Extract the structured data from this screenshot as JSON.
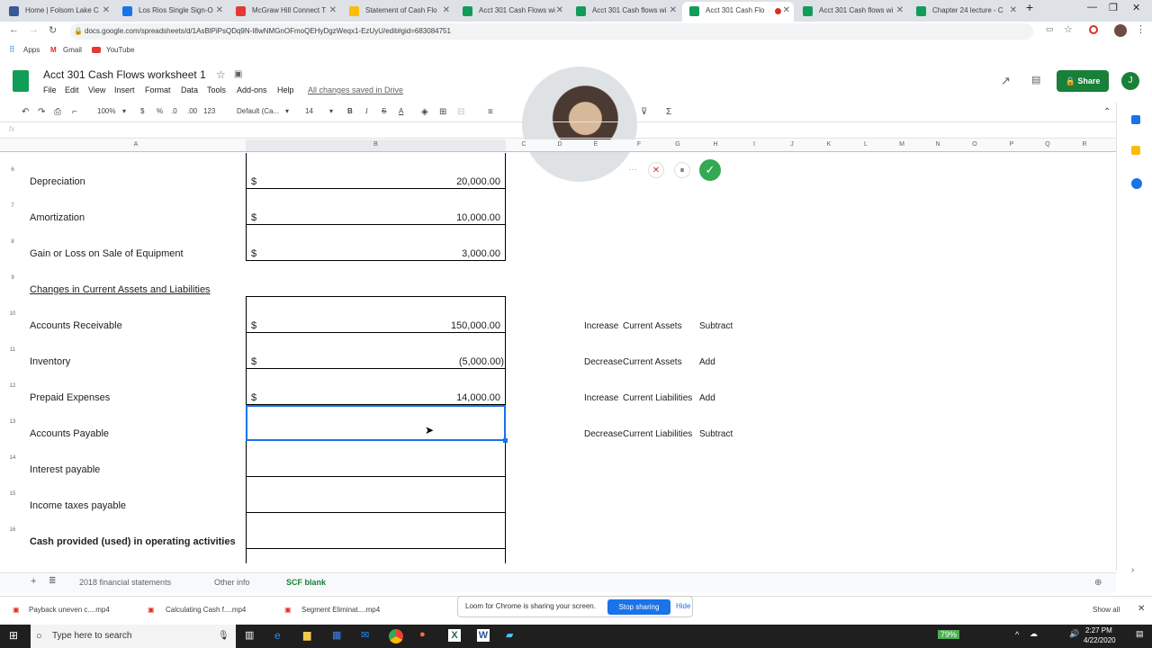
{
  "browser": {
    "tabs": [
      {
        "title": "Home | Folsom Lake C",
        "color": "#3b5998"
      },
      {
        "title": "Los Rios Single Sign-O",
        "color": "#1a73e8"
      },
      {
        "title": "McGraw Hill Connect T",
        "color": "#e53935"
      },
      {
        "title": "Statement of Cash Flo",
        "color": "#fbbc04"
      },
      {
        "title": "Acct 301 Cash Flows wi",
        "color": "#0f9d58"
      },
      {
        "title": "Acct 301 Cash flows wi",
        "color": "#0f9d58"
      },
      {
        "title": "Acct 301 Cash Flo",
        "color": "#0f9d58"
      },
      {
        "title": "Acct 301 Cash flows wi",
        "color": "#0f9d58"
      },
      {
        "title": "Chapter 24 lecture - C",
        "color": "#0f9d58"
      }
    ],
    "url": "docs.google.com/spreadsheets/d/1AsBlPiPsQDq9N-I8wNMGnOFmoQEHyDgzWeqx1-EzUyU/edit#gid=683084751",
    "bookmarks": [
      "Apps",
      "Gmail",
      "YouTube"
    ]
  },
  "sheets": {
    "title": "Acct 301 Cash Flows worksheet 1",
    "menu": [
      "File",
      "Edit",
      "View",
      "Insert",
      "Format",
      "Data",
      "Tools",
      "Add-ons",
      "Help"
    ],
    "saved": "All changes saved in Drive",
    "share": "Share",
    "avatar": "J",
    "toolbar": {
      "zoom": "100%",
      "currency": "$",
      "percent": "%",
      "dec0": ".0",
      "dec00": ".00",
      "more_formats": "123",
      "font": "Default (Ca...",
      "font_size": "14",
      "bold": "B",
      "italic": "I",
      "strike": "S",
      "text_color": "A"
    },
    "fx": "fx",
    "columns": [
      "A",
      "B",
      "C",
      "D",
      "E",
      "F",
      "G",
      "H",
      "I",
      "J",
      "K",
      "L",
      "M",
      "N",
      "O",
      "P",
      "Q",
      "R"
    ],
    "rows": [
      {
        "num": "6",
        "label": "Depreciation",
        "dollar": "$",
        "amount": "20,000.00"
      },
      {
        "num": "7",
        "label": "Amortization",
        "dollar": "$",
        "amount": "10,000.00"
      },
      {
        "num": "8",
        "label": "Gain or Loss on Sale of Equipment",
        "dollar": "$",
        "amount": "3,000.00"
      },
      {
        "num": "9",
        "label": "Changes in Current Assets and Liabilities",
        "dollar": "",
        "amount": ""
      },
      {
        "num": "10",
        "label": "Accounts Receivable",
        "dollar": "$",
        "amount": "150,000.00"
      },
      {
        "num": "11",
        "label": "Inventory",
        "dollar": "$",
        "amount": "(5,000.00)"
      },
      {
        "num": "12",
        "label": "Prepaid Expenses",
        "dollar": "$",
        "amount": "14,000.00"
      },
      {
        "num": "13",
        "label": "Accounts Payable",
        "dollar": "",
        "amount": ""
      },
      {
        "num": "14",
        "label": "Interest payable",
        "dollar": "",
        "amount": ""
      },
      {
        "num": "15",
        "label": "Income taxes payable",
        "dollar": "",
        "amount": ""
      },
      {
        "num": "16",
        "label": "Cash provided (used) in operating activities",
        "dollar": "",
        "amount": ""
      }
    ],
    "notes": [
      {
        "change": "Increase",
        "type": "Current Assets",
        "action": "Subtract"
      },
      {
        "change": "Decrease",
        "type": "Current Assets",
        "action": "Add"
      },
      {
        "change": "Increase",
        "type": "Current Liabilities",
        "action": "Add"
      },
      {
        "change": "Decrease",
        "type": "Current Liabilities",
        "action": "Subtract"
      }
    ],
    "sheet_tabs": [
      "2018 financial statements",
      "Other info",
      "SCF blank"
    ]
  },
  "downloads": [
    "Payback uneven c....mp4",
    "Calculating Cash f....mp4",
    "Segment Eliminat....mp4"
  ],
  "downloads_showall": "Show all",
  "loom": {
    "message": "Loom for Chrome is sharing your screen.",
    "stop": "Stop sharing",
    "hide": "Hide"
  },
  "taskbar": {
    "search": "Type here to search",
    "battery": "79%",
    "time": "2:27 PM",
    "date": "4/22/2020"
  }
}
